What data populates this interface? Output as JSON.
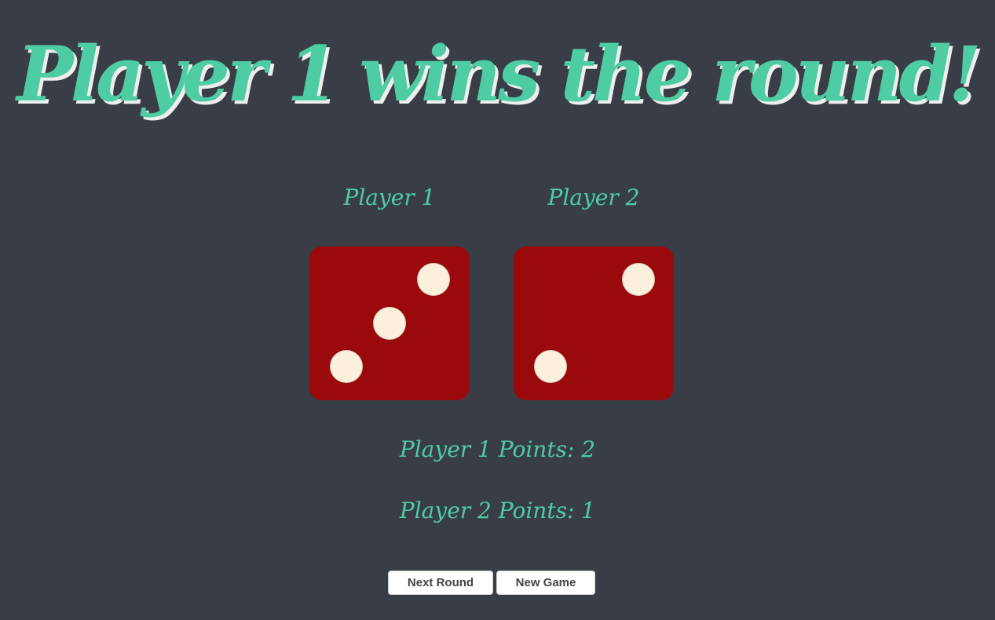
{
  "colors": {
    "background": "#393e46",
    "accent": "#4ecca3",
    "title_shadow": "#eeeeee",
    "die_face": "#9a0a0d",
    "pip": "#fbf0dc"
  },
  "header": {
    "title": "Player 1 wins the round!"
  },
  "players": [
    {
      "label": "Player 1",
      "die_value": 3
    },
    {
      "label": "Player 2",
      "die_value": 2
    }
  ],
  "scores": {
    "player1": "Player 1 Points: 2",
    "player2": "Player 2 Points: 1"
  },
  "buttons": {
    "next_round": "Next Round",
    "new_game": "New Game"
  }
}
